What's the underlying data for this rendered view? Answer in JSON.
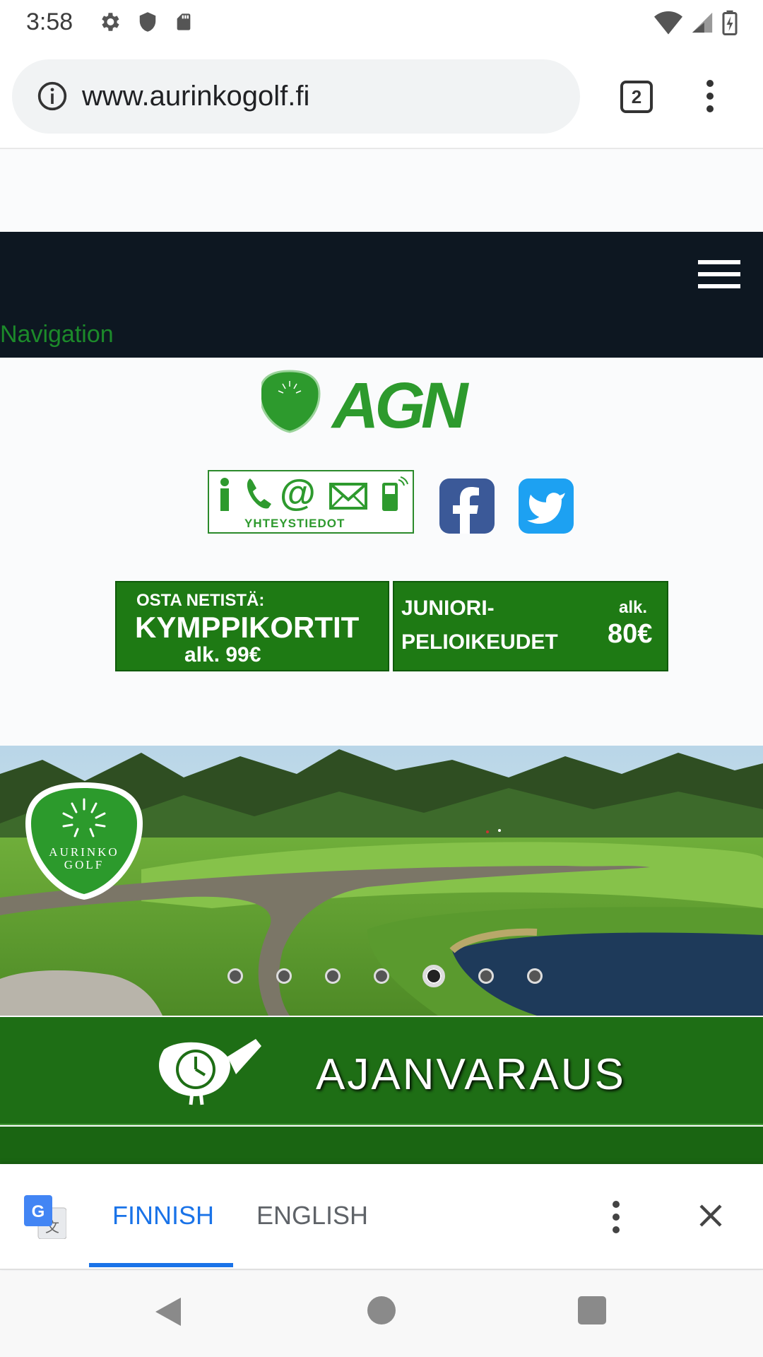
{
  "status_bar": {
    "time": "3:58"
  },
  "browser": {
    "url": "www.aurinkogolf.fi",
    "tab_count": "2"
  },
  "nav": {
    "label": "Navigation"
  },
  "logo": {
    "agn_text": "AGN",
    "club_text_1": "AURINKO",
    "club_text_2": "GOLF"
  },
  "contact": {
    "label": "YHTEYSTIEDOT"
  },
  "banners": {
    "left": {
      "line1": "OSTA NETISTÄ:",
      "line2": "KYMPPIKORTIT",
      "line3": "alk. 99€"
    },
    "right": {
      "line1": "JUNIORI-",
      "line2": "PELIOIKEUDET",
      "price_prefix": "alk.",
      "price": "80€"
    }
  },
  "hero": {
    "badge_line1": "AURINKO",
    "badge_line2": "GOLF",
    "slides": 7,
    "active_slide": 5
  },
  "booking": {
    "label": "AJANVARAUS"
  },
  "translate": {
    "tab_source": "FINNISH",
    "tab_target": "ENGLISH",
    "active": "FINNISH"
  }
}
